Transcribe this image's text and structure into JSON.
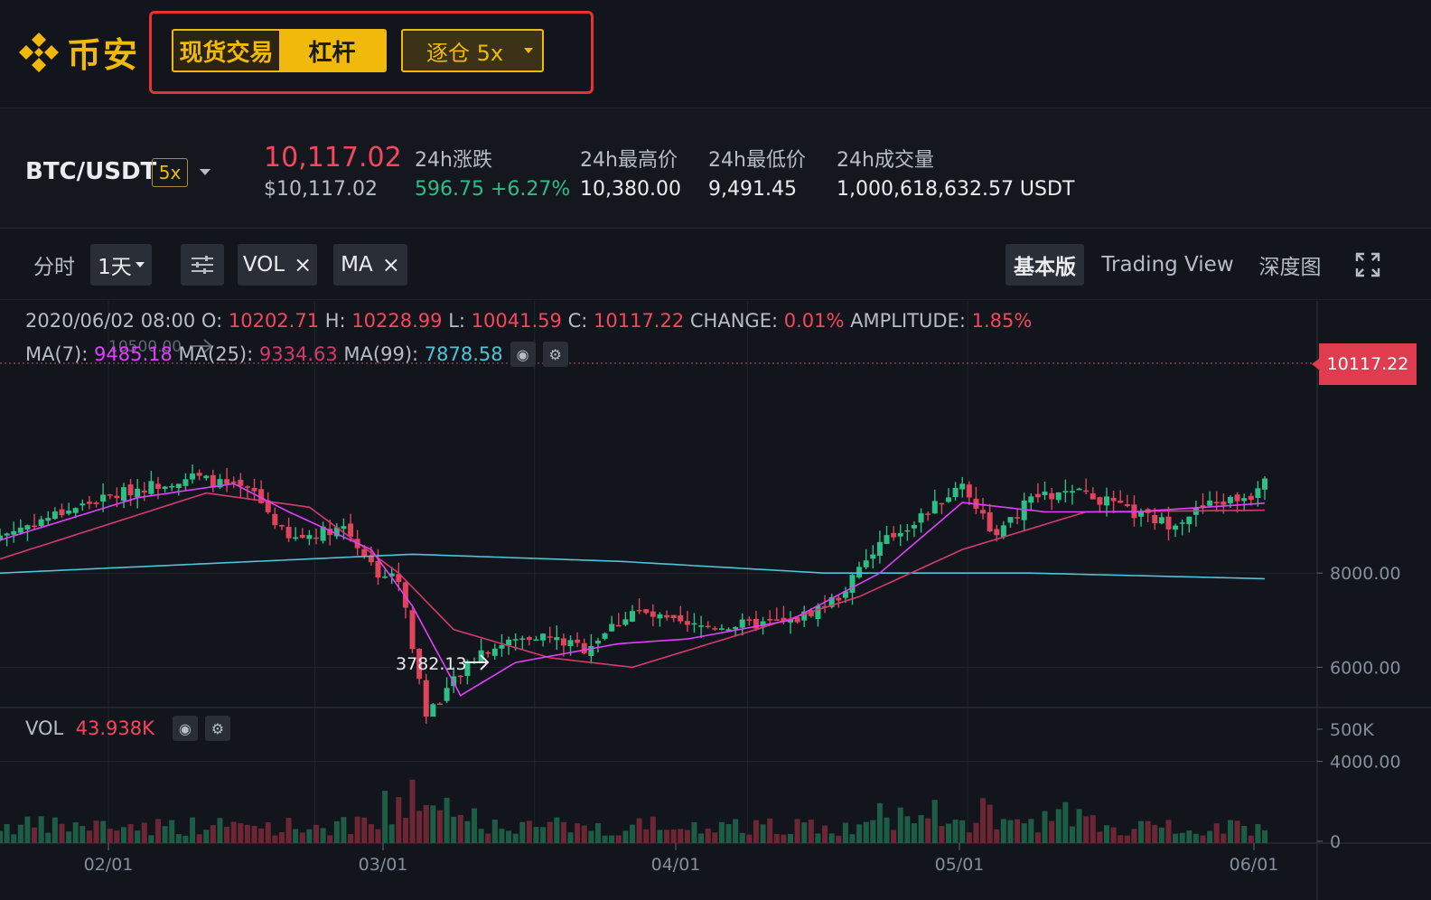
{
  "header": {
    "brand": "币安",
    "mode_tabs": [
      "现货交易",
      "杠杆"
    ],
    "leverage_select": "逐仓 5x"
  },
  "ticker": {
    "pair": "BTC/USDT",
    "leverage_badge": "5x",
    "last_price": "10,117.02",
    "usd_price": "$10,117.02",
    "change_label": "24h涨跌",
    "change_value": "596.75 +6.27%",
    "high_label": "24h最高价",
    "high_value": "10,380.00",
    "low_label": "24h最低价",
    "low_value": "9,491.45",
    "volume_label": "24h成交量",
    "volume_value": "1,000,618,632.57 USDT"
  },
  "toolbar": {
    "time_label": "分时",
    "interval": "1天",
    "indicators": [
      "VOL",
      "MA"
    ],
    "views": [
      "基本版",
      "Trading View",
      "深度图"
    ],
    "active_view": "基本版"
  },
  "legend": {
    "date": "2020/06/02 08:00",
    "o_label": "O:",
    "o_value": "10202.71",
    "h_label": "H:",
    "h_value": "10228.99",
    "l_label": "L:",
    "l_value": "10041.59",
    "c_label": "C:",
    "c_value": "10117.22",
    "change_label": "CHANGE:",
    "change_value": "0.01%",
    "amp_label": "AMPLITUDE:",
    "amp_value": "1.85%",
    "ma7_label": "MA(7):",
    "ma7_value": "9485.18",
    "ma25_label": "MA(25):",
    "ma25_value": "9334.63",
    "ma99_label": "MA(99):",
    "ma99_value": "7878.58",
    "vol_label": "VOL",
    "vol_value": "43.938K"
  },
  "chart": {
    "current_price_tag": "10117.22",
    "low_marker": "3782.13",
    "high_marker": "10500.00",
    "y_ticks": [
      "8000.00",
      "6000.00",
      "4000.00"
    ],
    "vol_ticks": [
      "500K",
      "0"
    ],
    "x_ticks": [
      "02/01",
      "03/01",
      "04/01",
      "05/01",
      "06/01"
    ]
  },
  "chart_data": {
    "type": "candlestick",
    "interval": "1d",
    "ylim": [
      3100,
      11000
    ],
    "x_labels": [
      "02/01",
      "03/01",
      "04/01",
      "05/01",
      "06/01"
    ],
    "close_anchors": [
      [
        0,
        8800
      ],
      [
        10,
        9350
      ],
      [
        20,
        9800
      ],
      [
        28,
        10050
      ],
      [
        37,
        9700
      ],
      [
        42,
        8700
      ],
      [
        50,
        9000
      ],
      [
        55,
        8000
      ],
      [
        58,
        7900
      ],
      [
        62,
        5000
      ],
      [
        64,
        5350
      ],
      [
        70,
        6350
      ],
      [
        78,
        6700
      ],
      [
        85,
        6400
      ],
      [
        92,
        7200
      ],
      [
        100,
        6850
      ],
      [
        108,
        6900
      ],
      [
        115,
        6950
      ],
      [
        122,
        7500
      ],
      [
        128,
        8600
      ],
      [
        135,
        9300
      ],
      [
        140,
        9900
      ],
      [
        145,
        8750
      ],
      [
        150,
        9600
      ],
      [
        158,
        9700
      ],
      [
        165,
        9250
      ],
      [
        170,
        9050
      ],
      [
        176,
        9450
      ],
      [
        182,
        9650
      ],
      [
        184,
        10117
      ]
    ],
    "ma7_anchors": [
      [
        0,
        8700
      ],
      [
        20,
        9600
      ],
      [
        34,
        9900
      ],
      [
        42,
        9300
      ],
      [
        54,
        8500
      ],
      [
        60,
        7300
      ],
      [
        67,
        5400
      ],
      [
        75,
        6100
      ],
      [
        90,
        6500
      ],
      [
        100,
        6600
      ],
      [
        115,
        7000
      ],
      [
        128,
        8000
      ],
      [
        140,
        9500
      ],
      [
        152,
        9300
      ],
      [
        165,
        9300
      ],
      [
        184,
        9485
      ]
    ],
    "ma25_anchors": [
      [
        0,
        8300
      ],
      [
        30,
        9700
      ],
      [
        45,
        9400
      ],
      [
        58,
        8000
      ],
      [
        66,
        6800
      ],
      [
        80,
        6200
      ],
      [
        92,
        6000
      ],
      [
        110,
        6800
      ],
      [
        125,
        7500
      ],
      [
        140,
        8500
      ],
      [
        158,
        9300
      ],
      [
        184,
        9335
      ]
    ],
    "ma99_anchors": [
      [
        0,
        8000
      ],
      [
        30,
        8200
      ],
      [
        60,
        8400
      ],
      [
        90,
        8250
      ],
      [
        120,
        8000
      ],
      [
        150,
        8000
      ],
      [
        184,
        7880
      ]
    ]
  }
}
